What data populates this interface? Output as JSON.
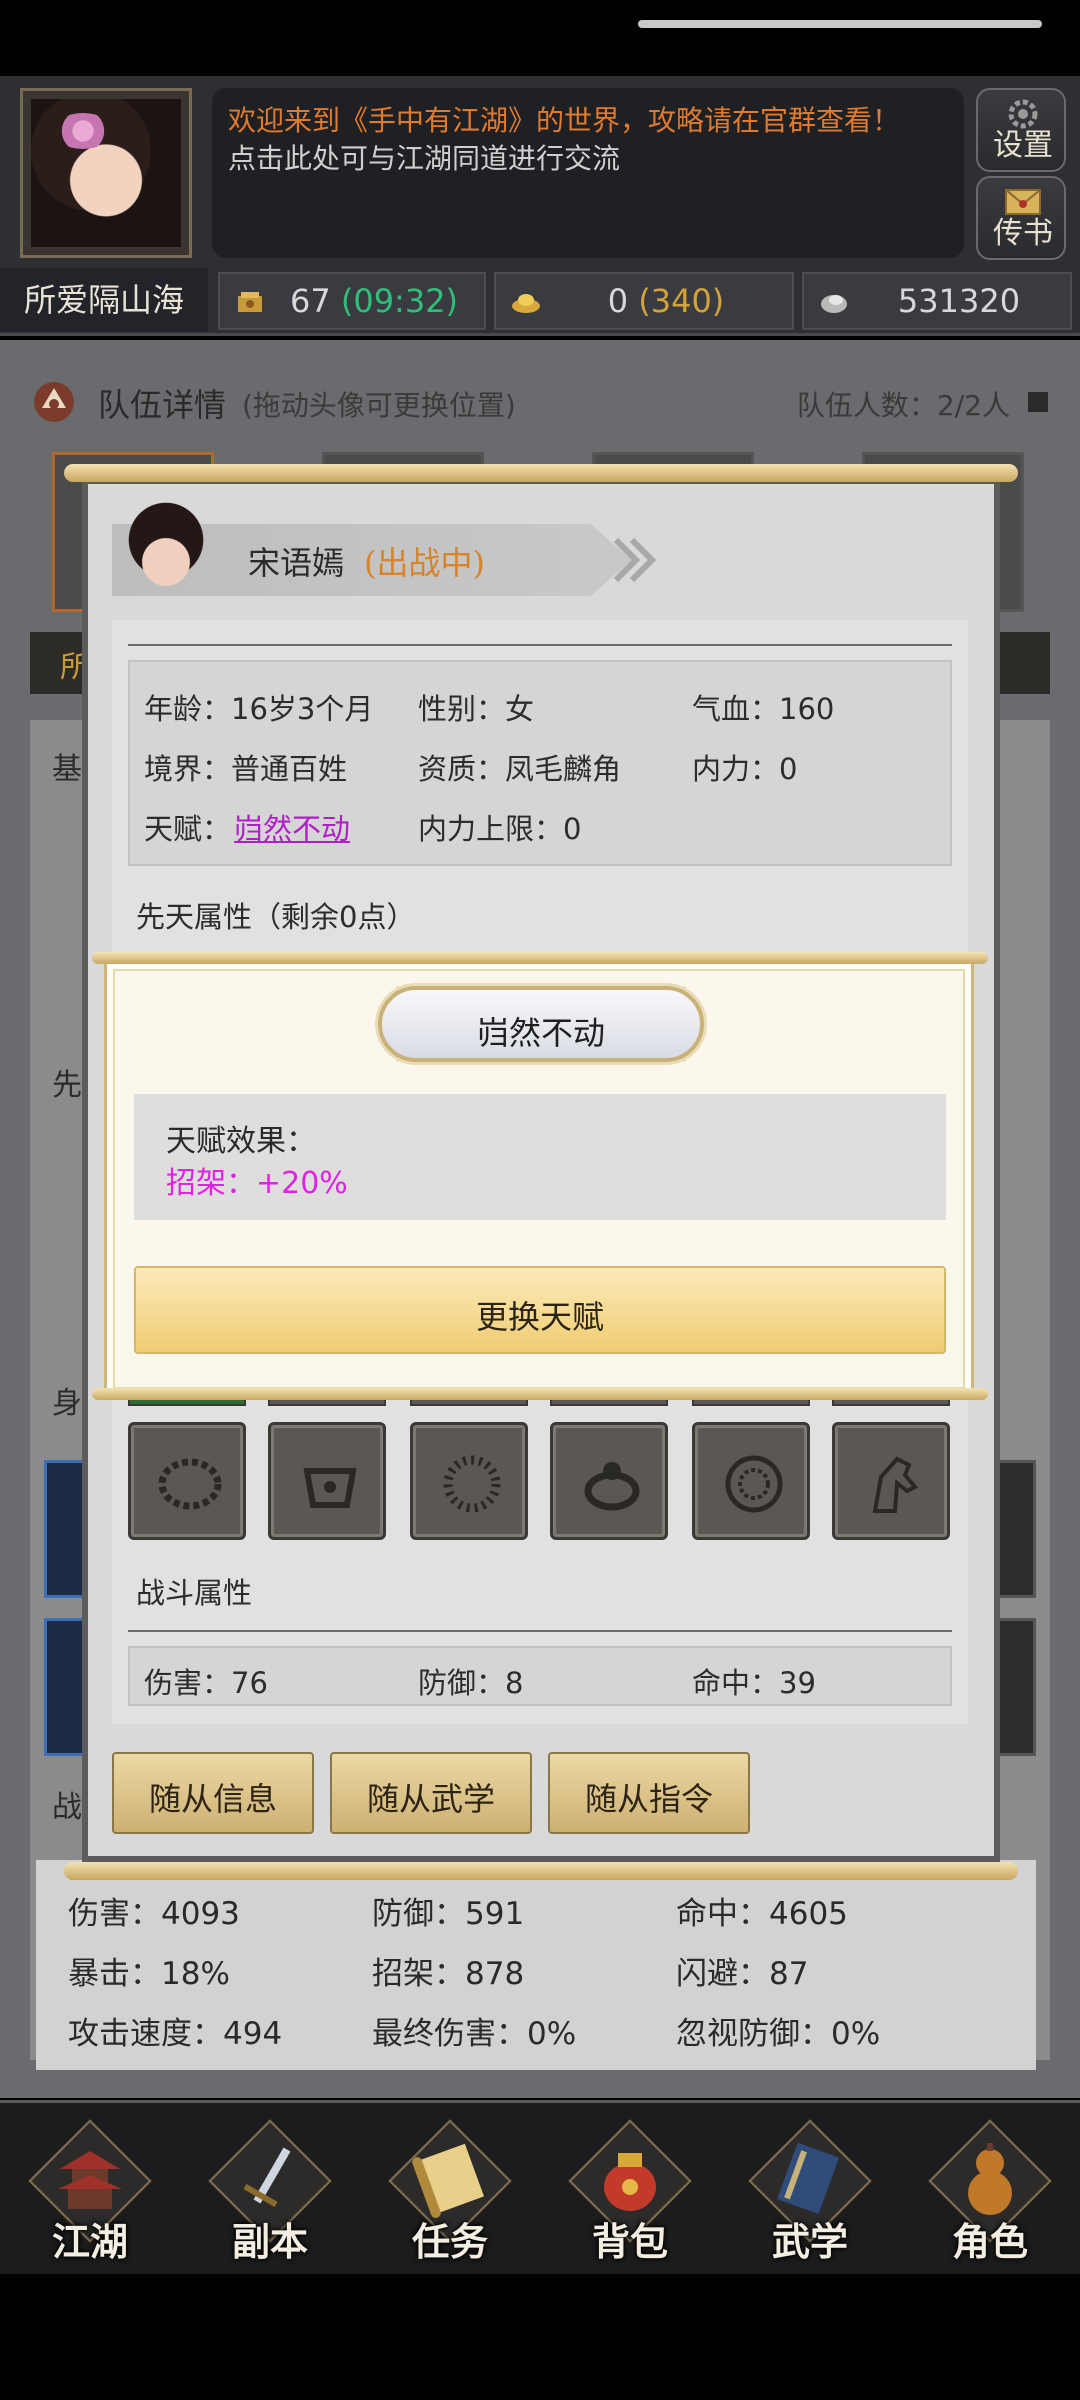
{
  "header": {
    "announcement_line1": "欢迎来到《手中有江湖》的世界，攻略请在官群查看！",
    "announcement_line2": "点击此处可与江湖同道进行交流",
    "settings_label": "设置",
    "mail_label": "传书",
    "player_name": "所爱隔山海"
  },
  "resources": [
    {
      "icon": "stamina-icon",
      "value": "67",
      "extra": "(09:32)",
      "extra_color": "#2fbf7a"
    },
    {
      "icon": "gold-ingot-icon",
      "value": "0",
      "extra": "(340)",
      "extra_color": "#d2a23b"
    },
    {
      "icon": "silver-icon",
      "value": "531320",
      "extra": ""
    }
  ],
  "team": {
    "title": "队伍详情",
    "hint": "(拖动头像可更换位置)",
    "count": "队伍人数：2/2人"
  },
  "background_labels": {
    "band": "所",
    "basic": "基",
    "attr": "先",
    "body": "身",
    "combat": "战"
  },
  "team_stats": {
    "row1": [
      "伤害：4093",
      "防御：591",
      "命中：4605"
    ],
    "row2": [
      "暴击：18%",
      "招架：878",
      "闪避：87"
    ],
    "row3": [
      "攻击速度：494",
      "最终伤害：0%",
      "忽视防御：0%"
    ]
  },
  "companion": {
    "name": "宋语嫣",
    "status": "(出战中)",
    "age": "年龄：16岁3个月",
    "gender": "性别：女",
    "hp": "气血：160",
    "realm": "境界：普通百姓",
    "aptitude": "资质：凤毛麟角",
    "inner_power": "内力：0",
    "talent_label": "天赋：",
    "talent_name": "岿然不动",
    "inner_power_max": "内力上限：0",
    "innate_label": "先天属性（剩余0点）",
    "combat_label": "战斗属性",
    "combat_stats": [
      "伤害：76",
      "防御：8",
      "命中：39"
    ],
    "equipment": [
      "necklace-icon",
      "bracer-icon",
      "bead-bracelet-icon",
      "ring-icon",
      "medallion-icon",
      "horse-icon"
    ],
    "buttons": [
      "随从信息",
      "随从武学",
      "随从指令"
    ]
  },
  "talent_popup": {
    "title": "岿然不动",
    "effect_title": "天赋效果：",
    "effect_value": "招架：+20%",
    "effect_color": "#e021e6",
    "change_button": "更换天赋"
  },
  "nav": [
    {
      "label": "江湖",
      "icon": "pagoda-icon"
    },
    {
      "label": "副本",
      "icon": "sword-icon"
    },
    {
      "label": "任务",
      "icon": "scroll-icon"
    },
    {
      "label": "背包",
      "icon": "pouch-icon"
    },
    {
      "label": "武学",
      "icon": "book-icon"
    },
    {
      "label": "角色",
      "icon": "gourd-icon"
    }
  ]
}
